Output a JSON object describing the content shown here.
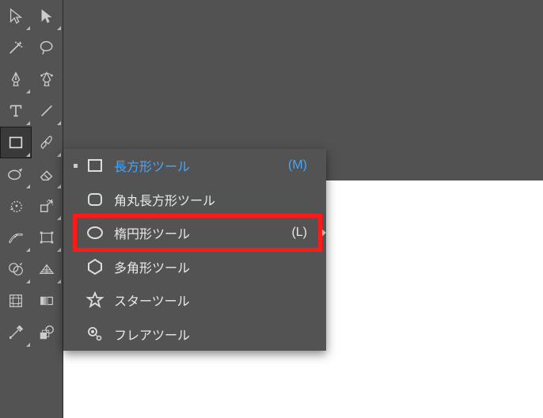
{
  "toolbar": {
    "rows": [
      [
        "selection-tool",
        "direct-selection-tool"
      ],
      [
        "magic-wand-tool",
        "lasso-tool"
      ],
      [
        "pen-tool",
        "curvature-tool"
      ],
      [
        "type-tool",
        "line-segment-tool"
      ],
      [
        "rectangle-tool",
        "paintbrush-tool"
      ],
      [
        "shaper-tool",
        "eraser-tool"
      ],
      [
        "rotate-tool",
        "scale-tool"
      ],
      [
        "width-tool",
        "free-transform-tool"
      ],
      [
        "shape-builder-tool",
        "perspective-grid-tool"
      ],
      [
        "mesh-tool",
        "gradient-tool"
      ],
      [
        "eyedropper-tool",
        "blend-tool"
      ]
    ],
    "selected": "rectangle-tool"
  },
  "flyout": {
    "items": [
      {
        "icon": "rectangle-icon",
        "label": "長方形ツール",
        "shortcut": "(M)",
        "active": true,
        "checked": true
      },
      {
        "icon": "rounded-rectangle-icon",
        "label": "角丸長方形ツール",
        "shortcut": "",
        "active": false,
        "checked": false
      },
      {
        "icon": "ellipse-icon",
        "label": "楕円形ツール",
        "shortcut": "(L)",
        "active": false,
        "checked": false,
        "highlighted": true
      },
      {
        "icon": "polygon-icon",
        "label": "多角形ツール",
        "shortcut": "",
        "active": false,
        "checked": false
      },
      {
        "icon": "star-icon",
        "label": "スターツール",
        "shortcut": "",
        "active": false,
        "checked": false
      },
      {
        "icon": "flare-icon",
        "label": "フレアツール",
        "shortcut": "",
        "active": false,
        "checked": false
      }
    ]
  }
}
